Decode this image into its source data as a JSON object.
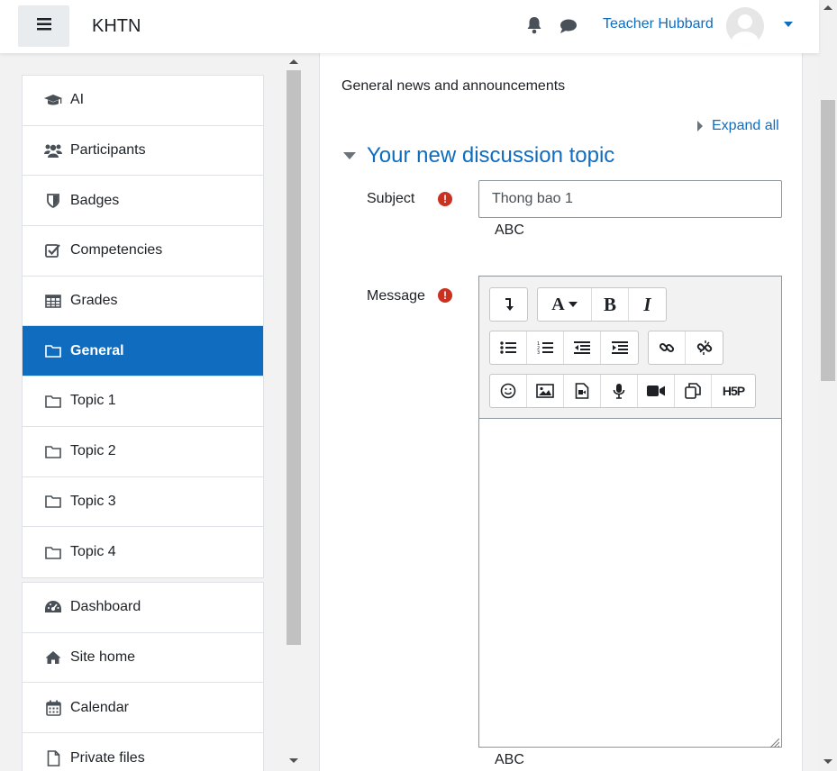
{
  "navbar": {
    "brand": "KHTN",
    "user_name": "Teacher Hubbard"
  },
  "drawer": {
    "course_items": [
      {
        "label": "AI",
        "icon": "graduation-cap-icon"
      },
      {
        "label": "Participants",
        "icon": "users-icon"
      },
      {
        "label": "Badges",
        "icon": "shield-icon"
      },
      {
        "label": "Competencies",
        "icon": "checkbox-icon"
      },
      {
        "label": "Grades",
        "icon": "table-icon"
      },
      {
        "label": "General",
        "icon": "folder-icon",
        "active": true
      },
      {
        "label": "Topic 1",
        "icon": "folder-icon"
      },
      {
        "label": "Topic 2",
        "icon": "folder-icon"
      },
      {
        "label": "Topic 3",
        "icon": "folder-icon"
      },
      {
        "label": "Topic 4",
        "icon": "folder-icon"
      }
    ],
    "site_items": [
      {
        "label": "Dashboard",
        "icon": "dashboard-icon"
      },
      {
        "label": "Site home",
        "icon": "home-icon"
      },
      {
        "label": "Calendar",
        "icon": "calendar-icon"
      },
      {
        "label": "Private files",
        "icon": "file-icon"
      }
    ]
  },
  "main": {
    "forum_intro": "General news and announcements",
    "expand_all": "Expand all",
    "section_title": "Your new discussion topic",
    "subject": {
      "label": "Subject",
      "value": "Thong bao 1",
      "hint": "ABC"
    },
    "message": {
      "label": "Message",
      "hint": "ABC"
    },
    "toolbar": {
      "row1": [
        "collapse",
        "font-color",
        "bold",
        "italic"
      ],
      "row2": [
        "unordered-list",
        "ordered-list",
        "outdent",
        "indent",
        "link",
        "unlink"
      ],
      "row3": [
        "emoji",
        "image",
        "media",
        "record-audio",
        "record-video",
        "manage-files",
        "h5p"
      ],
      "bold_label": "B",
      "italic_label": "I",
      "font_label": "A",
      "h5p_label": "H5P"
    }
  },
  "colors": {
    "brand_blue": "#0f6cbf",
    "required_red": "#ca3120"
  }
}
